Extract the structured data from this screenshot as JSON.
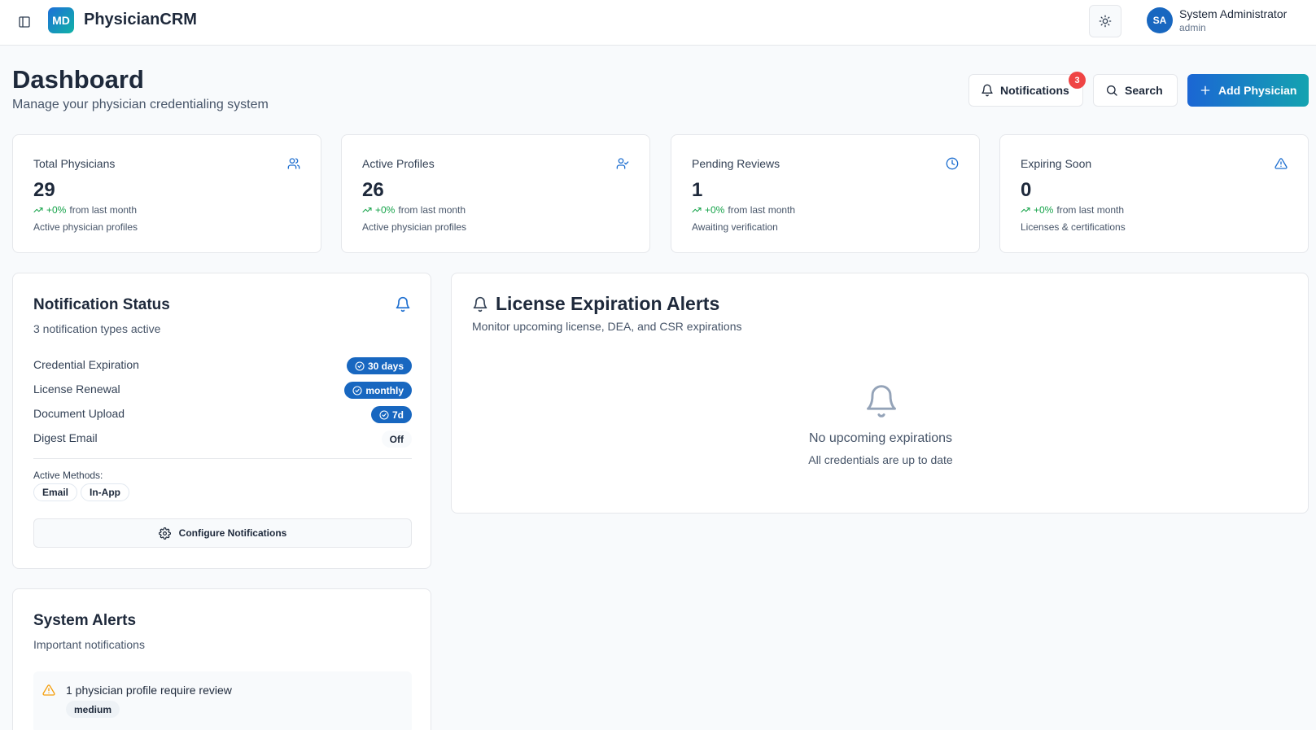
{
  "app": {
    "logo_text": "MD",
    "title": "PhysicianCRM"
  },
  "user": {
    "initials": "SA",
    "name": "System Administrator",
    "role": "admin"
  },
  "header": {
    "title": "Dashboard",
    "subtitle": "Manage your physician credentialing system",
    "notifications_label": "Notifications",
    "notifications_count": "3",
    "search_label": "Search",
    "add_label": "Add Physician"
  },
  "stats": [
    {
      "label": "Total Physicians",
      "value": "29",
      "change": "+0%",
      "change_suffix": "from last month",
      "description": "Active physician profiles",
      "icon": "users-icon"
    },
    {
      "label": "Active Profiles",
      "value": "26",
      "change": "+0%",
      "change_suffix": "from last month",
      "description": "Active physician profiles",
      "icon": "user-check-icon"
    },
    {
      "label": "Pending Reviews",
      "value": "1",
      "change": "+0%",
      "change_suffix": "from last month",
      "description": "Awaiting verification",
      "icon": "clock-icon"
    },
    {
      "label": "Expiring Soon",
      "value": "0",
      "change": "+0%",
      "change_suffix": "from last month",
      "description": "Licenses & certifications",
      "icon": "alert-triangle-icon"
    }
  ],
  "notification_status": {
    "title": "Notification Status",
    "subtitle": "3 notification types active",
    "rows": [
      {
        "label": "Credential Expiration",
        "value": "30 days",
        "enabled": true
      },
      {
        "label": "License Renewal",
        "value": "monthly",
        "enabled": true
      },
      {
        "label": "Document Upload",
        "value": "7d",
        "enabled": true
      },
      {
        "label": "Digest Email",
        "value": "Off",
        "enabled": false
      }
    ],
    "methods_label": "Active Methods:",
    "methods": [
      "Email",
      "In-App"
    ],
    "configure_label": "Configure Notifications"
  },
  "license_alerts": {
    "title": "License Expiration Alerts",
    "subtitle": "Monitor upcoming license, DEA, and CSR expirations",
    "empty_title": "No upcoming expirations",
    "empty_subtitle": "All credentials are up to date"
  },
  "system_alerts": {
    "title": "System Alerts",
    "subtitle": "Important notifications",
    "items": [
      {
        "text": "1 physician profile require review",
        "severity": "medium"
      }
    ]
  },
  "colors": {
    "primary": "#1867c0",
    "accent_gradient_start": "#1b66d4",
    "accent_gradient_end": "#14a3b0",
    "success": "#16a34a",
    "danger": "#ef4444",
    "warning": "#f59e0b"
  }
}
